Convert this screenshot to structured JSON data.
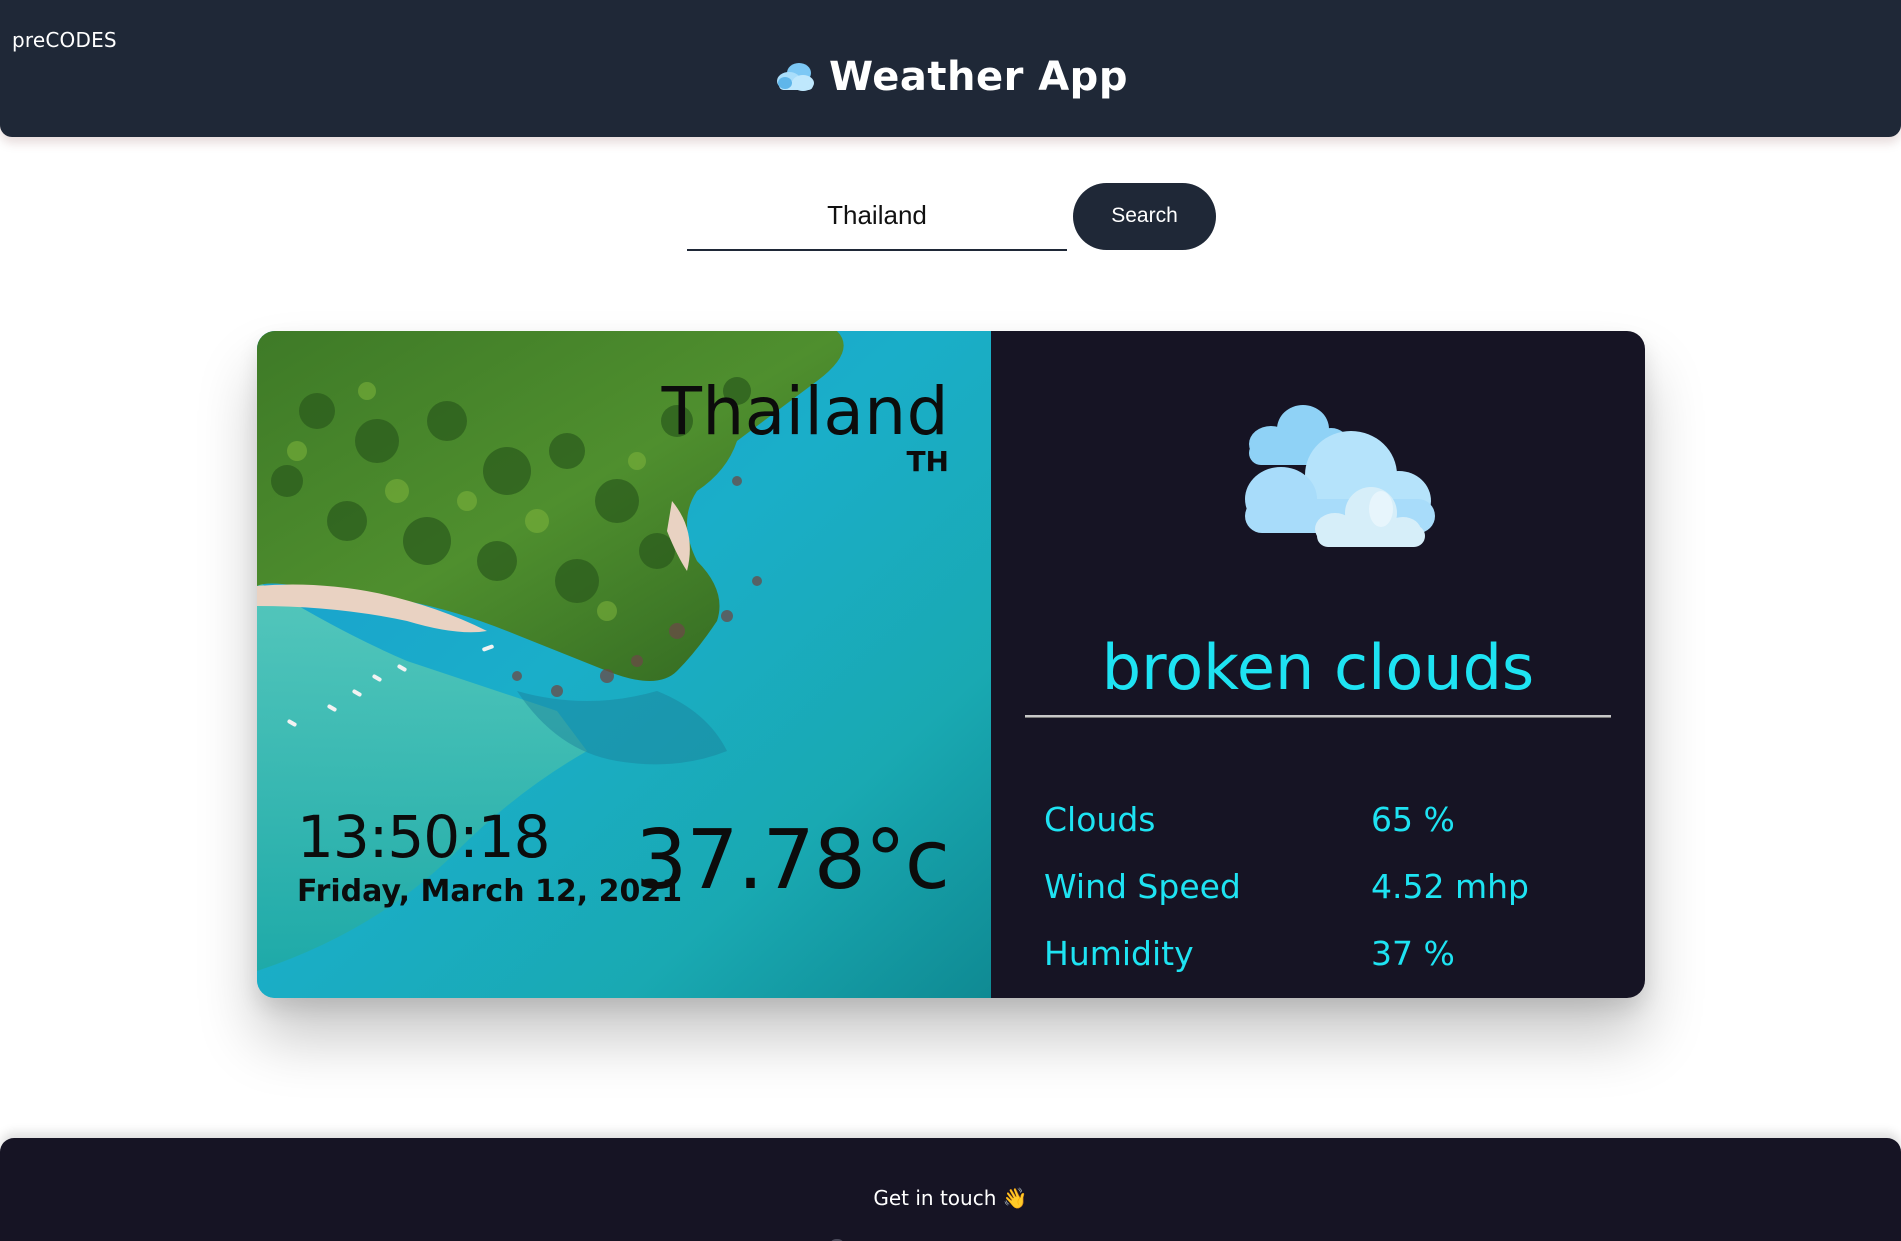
{
  "header": {
    "brand": "preCODES",
    "title": "Weather App",
    "title_icon": "cloud-icon"
  },
  "search": {
    "value": "Thailand",
    "button_label": "Search"
  },
  "card": {
    "city": "Thailand",
    "country_code": "TH",
    "time": "13:50:18",
    "date": "Friday, March 12, 2021",
    "temperature": "37.78",
    "temperature_unit": "°c",
    "weather_icon": "broken-clouds-icon",
    "description": "broken clouds",
    "stats": [
      {
        "label": "Clouds",
        "value": "65 %"
      },
      {
        "label": "Wind Speed",
        "value": "4.52 mhp"
      },
      {
        "label": "Humidity",
        "value": "37 %"
      }
    ],
    "accent_color": "#1ee3f2"
  },
  "footer": {
    "text": "Get in touch 👋"
  },
  "colors": {
    "header_bg": "#1f2837",
    "panel_bg": "#161424",
    "accent": "#1ee3f2"
  }
}
